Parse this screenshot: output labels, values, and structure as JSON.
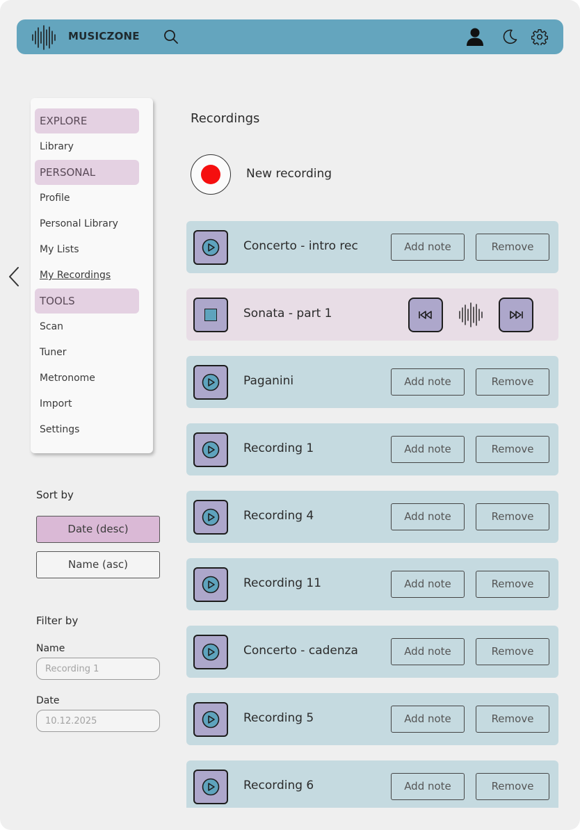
{
  "header": {
    "brand": "MUSICZONE",
    "icons": [
      "soundwave-logo-icon",
      "search-icon",
      "user-icon",
      "moon-icon",
      "gear-icon"
    ],
    "color": "#64a5be"
  },
  "sidebar": {
    "items": [
      {
        "label": "EXPLORE",
        "type": "section"
      },
      {
        "label": "Library",
        "type": "link"
      },
      {
        "label": "PERSONAL",
        "type": "section"
      },
      {
        "label": "Profile",
        "type": "link"
      },
      {
        "label": "Personal Library",
        "type": "link"
      },
      {
        "label": "My Lists",
        "type": "link"
      },
      {
        "label": "My Recordings",
        "type": "link",
        "current": true
      },
      {
        "label": "TOOLS",
        "type": "section"
      },
      {
        "label": "Scan",
        "type": "link"
      },
      {
        "label": "Tuner",
        "type": "link"
      },
      {
        "label": "Metronome",
        "type": "link"
      },
      {
        "label": "Import",
        "type": "link"
      },
      {
        "label": "Settings",
        "type": "link"
      }
    ]
  },
  "sort": {
    "label": "Sort by",
    "options": [
      "Date (desc)",
      "Name (asc)"
    ],
    "active": "Date (desc)"
  },
  "filter": {
    "label": "Filter by",
    "name_label": "Name",
    "name_placeholder": "Recording 1",
    "date_label": "Date",
    "date_placeholder": "10.12.2025"
  },
  "main": {
    "title": "Recordings",
    "new_recording_label": "New recording",
    "add_note_label": "Add note",
    "remove_label": "Remove",
    "recordings": [
      {
        "name": "Concerto - intro rec",
        "state": "idle"
      },
      {
        "name": "Sonata - part 1",
        "state": "playing"
      },
      {
        "name": "Paganini",
        "state": "idle"
      },
      {
        "name": "Recording 1",
        "state": "idle"
      },
      {
        "name": "Recording 4",
        "state": "idle"
      },
      {
        "name": "Recording 11",
        "state": "idle"
      },
      {
        "name": "Concerto - cadenza",
        "state": "idle"
      },
      {
        "name": "Recording 5",
        "state": "idle"
      },
      {
        "name": "Recording 6",
        "state": "idle"
      }
    ]
  },
  "colors": {
    "background": "#efefef",
    "section_highlight": "#e4d1e2",
    "sort_active": "#dab9d6",
    "row_idle": "#c5dae0",
    "row_playing": "#e8dde6",
    "play_button": "#ada7cb",
    "record_dot": "#f50f0f"
  }
}
